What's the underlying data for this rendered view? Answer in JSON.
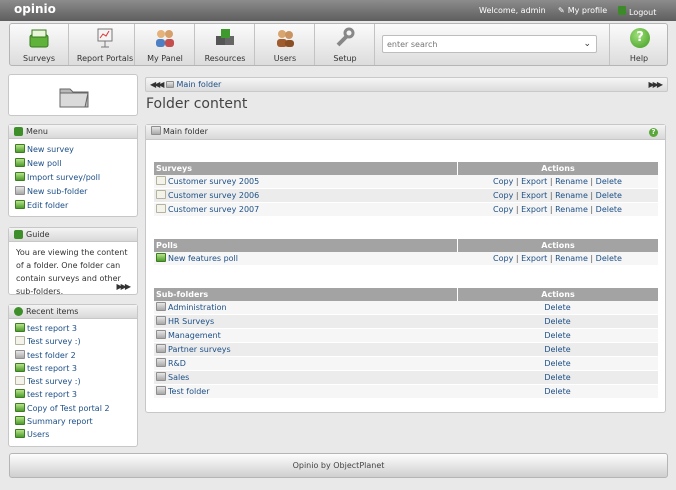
{
  "app": {
    "logo": "opinio"
  },
  "topbar": {
    "welcome": "Welcome, admin",
    "my_profile": "My profile",
    "logout": "Logout"
  },
  "toolbar": {
    "buttons": [
      {
        "label": "Surveys",
        "icon": "surveys-icon"
      },
      {
        "label": "Report Portals",
        "icon": "report-portals-icon"
      },
      {
        "label": "My Panel",
        "icon": "my-panel-icon"
      },
      {
        "label": "Resources",
        "icon": "resources-icon"
      },
      {
        "label": "Users",
        "icon": "users-icon"
      },
      {
        "label": "Setup",
        "icon": "setup-icon"
      }
    ],
    "search_placeholder": "enter search",
    "help_label": "Help"
  },
  "sidebar": {
    "menu": {
      "title": "Menu",
      "items": [
        "New survey",
        "New poll",
        "Import survey/poll",
        "New sub-folder",
        "Edit folder"
      ]
    },
    "guide": {
      "title": "Guide",
      "text": "You are viewing the content of a folder. One folder can contain surveys and other sub-folders."
    },
    "recent": {
      "title": "Recent items",
      "items": [
        "test report 3",
        "Test survey :)",
        "test folder 2",
        "test report 3",
        "Test survey :)",
        "test report 3",
        "Copy of Test portal 2",
        "Summary report",
        "Users"
      ]
    }
  },
  "breadcrumb": {
    "current": "Main folder"
  },
  "page": {
    "title": "Folder content",
    "panel_title": "Main folder"
  },
  "surveys": {
    "header": "Surveys",
    "actions_header": "Actions",
    "rows": [
      "Customer survey 2005",
      "Customer survey 2006",
      "Customer survey 2007"
    ],
    "actions": {
      "copy": "Copy",
      "export": "Export",
      "rename": "Rename",
      "delete": "Delete"
    }
  },
  "polls": {
    "header": "Polls",
    "actions_header": "Actions",
    "rows": [
      "New features poll"
    ]
  },
  "subfolders": {
    "header": "Sub-folders",
    "actions_header": "Actions",
    "rows": [
      "Administration",
      "HR Surveys",
      "Management",
      "Partner surveys",
      "R&D",
      "Sales",
      "Test folder"
    ],
    "delete": "Delete"
  },
  "footer": {
    "text": "Opinio by ObjectPlanet"
  }
}
